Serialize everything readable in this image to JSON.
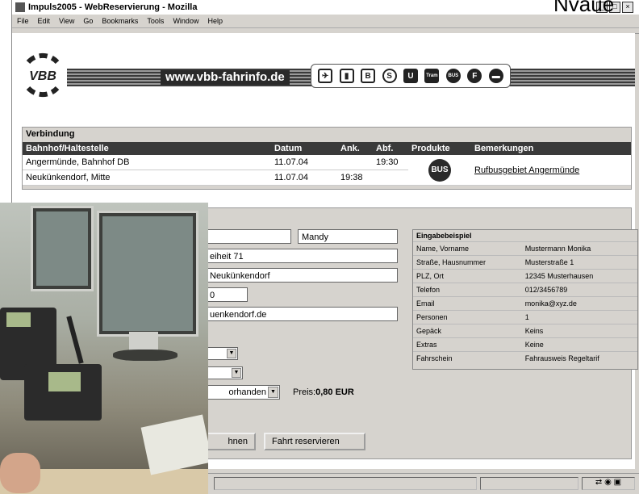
{
  "window": {
    "title": "Impuls2005 - WebReservierung - Mozilla",
    "corner_text": "Nvaue"
  },
  "menu": [
    "File",
    "Edit",
    "View",
    "Go",
    "Bookmarks",
    "Tools",
    "Window",
    "Help"
  ],
  "banner": {
    "logo_text": "VBB",
    "url": "www.vbb-fahrinfo.de",
    "product_icons": [
      {
        "name": "plane-icon",
        "glyph": "✈"
      },
      {
        "name": "train-icon",
        "glyph": "🚆"
      },
      {
        "name": "regional-icon",
        "glyph": "B"
      },
      {
        "name": "sbahn-icon",
        "glyph": "S"
      },
      {
        "name": "ubahn-icon",
        "glyph": "U"
      },
      {
        "name": "tram-icon",
        "glyph": "Tram"
      },
      {
        "name": "bus-icon",
        "glyph": "BUS"
      },
      {
        "name": "ferry-icon",
        "glyph": "F"
      },
      {
        "name": "car-icon",
        "glyph": "🚗"
      }
    ]
  },
  "connection": {
    "title": "Verbindung",
    "columns": [
      "Bahnhof/Haltestelle",
      "Datum",
      "Ank.",
      "Abf.",
      "Produkte",
      "Bemerkungen"
    ],
    "rows": [
      {
        "station": "Angermünde, Bahnhof DB",
        "date": "11.07.04",
        "arr": "",
        "dep": "19:30",
        "product": "BUS",
        "remark": "Rufbusgebiet Angermünde"
      },
      {
        "station": "Neukünkendorf, Mitte",
        "date": "11.07.04",
        "arr": "19:38",
        "dep": "",
        "product": "",
        "remark": ""
      }
    ]
  },
  "form": {
    "firstname": "Mandy",
    "street": "eiheit 71",
    "city": "Neukünkendorf",
    "plz": "0",
    "email": "uenkendorf.de",
    "ticket_select": "orhanden",
    "price_label": "Preis:",
    "price_value": "0,80 EUR",
    "btn_left": "hnen",
    "btn_reserve": "Fahrt reservieren"
  },
  "example": {
    "title": "Eingabebeispiel",
    "rows": [
      [
        "Name, Vorname",
        "Mustermann Monika"
      ],
      [
        "Straße, Hausnummer",
        "Musterstraße 1"
      ],
      [
        "PLZ, Ort",
        "12345 Musterhausen"
      ],
      [
        "Telefon",
        "012/3456789"
      ],
      [
        "Email",
        "monika@xyz.de"
      ],
      [
        "Personen",
        "1"
      ],
      [
        "Gepäck",
        "Keins"
      ],
      [
        "Extras",
        "Keine"
      ],
      [
        "Fahrschein",
        "Fahrausweis Regeltarif"
      ]
    ]
  }
}
